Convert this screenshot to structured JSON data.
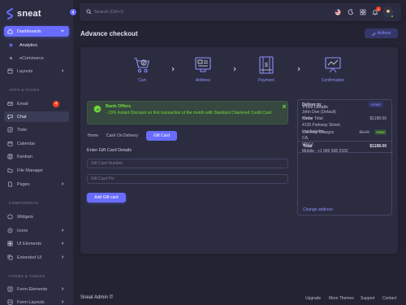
{
  "brand": {
    "name": "sneat"
  },
  "sidebar": {
    "items": [
      {
        "label": "Dashboards"
      },
      {
        "label": "Analytics"
      },
      {
        "label": "eCommerce"
      },
      {
        "label": "Layouts"
      },
      {
        "label": "Email",
        "badge": "4"
      },
      {
        "label": "Chat"
      },
      {
        "label": "Todo"
      },
      {
        "label": "Calendar"
      },
      {
        "label": "Kanban"
      },
      {
        "label": "File Manager"
      },
      {
        "label": "Pages"
      },
      {
        "label": "Widgets"
      },
      {
        "label": "Icons"
      },
      {
        "label": "UI Elements"
      },
      {
        "label": "Extended UI"
      },
      {
        "label": "Form Elements"
      },
      {
        "label": "Form Layouts"
      }
    ],
    "sections": [
      {
        "label": "APPS & PAGES"
      },
      {
        "label": "COMPONENTS"
      },
      {
        "label": "FORMS & TABLES"
      }
    ]
  },
  "navbar": {
    "search_placeholder": "Search (Ctrl+/)",
    "notification_count": "4"
  },
  "page": {
    "title": "Advance checkout",
    "actions_label": "Actions"
  },
  "steps": [
    {
      "label": "Cart"
    },
    {
      "label": "Address"
    },
    {
      "label": "Payment"
    },
    {
      "label": "Confirmation"
    }
  ],
  "offer": {
    "title": "Bank Offers",
    "text": "- 20% Instant Discount on first transaction of the month with Standard Chartered Credit Card"
  },
  "tabs": [
    {
      "label": "Home"
    },
    {
      "label": "Cash On Delivery"
    },
    {
      "label": "Gift Card"
    }
  ],
  "gift_card": {
    "title": "Enter Gift Card Details",
    "number_placeholder": "Gift Card Number",
    "pin_placeholder": "Gift Card Pin",
    "button_label": "Add Gift card"
  },
  "price": {
    "title": "Price Details",
    "order_total_label": "Order Total",
    "order_total_value": "$1198.00",
    "delivery_label": "Delivery Charges",
    "delivery_old": "$5.00",
    "delivery_badge": "FREE",
    "total_label": "Total",
    "total_value": "$1198.00",
    "deliver_to_label": "Deliver to:",
    "home_badge": "HOME",
    "address_lines": [
      "John Doe (Default)",
      "Home",
      "4135 Parkway Street,",
      "Los Angeles,",
      "CA,",
      "90017.",
      "Mobile : +1 906 568 2332"
    ],
    "change_address": "Change address"
  },
  "footer": {
    "brand": "Sneat Admin ©",
    "links": [
      "Upgrade",
      "More Themes",
      "Support",
      "Contact"
    ]
  },
  "colors": {
    "primary": "#696cff",
    "success": "#71dd37",
    "danger": "#ff3e1d",
    "background": "#232333",
    "surface": "#2b2c40"
  }
}
